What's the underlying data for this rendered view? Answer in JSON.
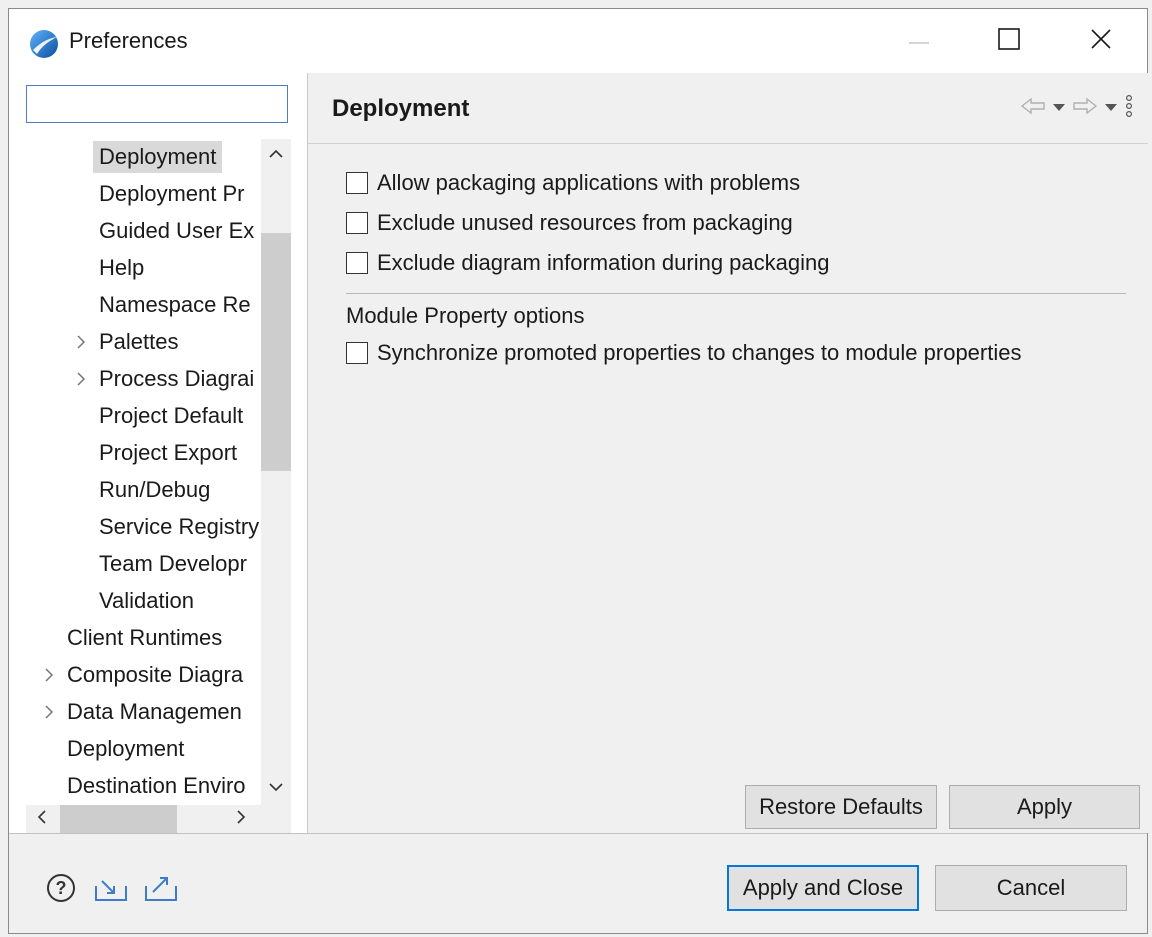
{
  "window": {
    "title": "Preferences",
    "app_icon": "eclipse-app-icon",
    "controls": [
      "minimize-icon",
      "maximize-icon",
      "close-icon"
    ]
  },
  "filter": {
    "value": "",
    "placeholder": ""
  },
  "tree": {
    "items": [
      {
        "label": "Deployment",
        "indent": 2,
        "expander": false,
        "selected": true
      },
      {
        "label": "Deployment Pr",
        "indent": 2,
        "expander": false
      },
      {
        "label": "Guided User Ex",
        "indent": 2,
        "expander": false
      },
      {
        "label": "Help",
        "indent": 2,
        "expander": false
      },
      {
        "label": "Namespace Re",
        "indent": 2,
        "expander": false
      },
      {
        "label": "Palettes",
        "indent": 2,
        "expander": true
      },
      {
        "label": "Process Diagrai",
        "indent": 2,
        "expander": true
      },
      {
        "label": "Project Default",
        "indent": 2,
        "expander": false
      },
      {
        "label": "Project Export",
        "indent": 2,
        "expander": false
      },
      {
        "label": "Run/Debug",
        "indent": 2,
        "expander": false
      },
      {
        "label": "Service Registry",
        "indent": 2,
        "expander": false
      },
      {
        "label": "Team Developr",
        "indent": 2,
        "expander": false
      },
      {
        "label": "Validation",
        "indent": 2,
        "expander": false
      },
      {
        "label": "Client Runtimes",
        "indent": 1,
        "expander": false
      },
      {
        "label": "Composite Diagra",
        "indent": 1,
        "expander": true
      },
      {
        "label": "Data Managemen",
        "indent": 1,
        "expander": true
      },
      {
        "label": "Deployment",
        "indent": 1,
        "expander": false
      },
      {
        "label": "Destination Enviro",
        "indent": 1,
        "expander": false
      }
    ]
  },
  "page": {
    "title": "Deployment",
    "options": [
      {
        "label": "Allow packaging applications with problems",
        "checked": false
      },
      {
        "label": "Exclude unused resources from packaging",
        "checked": false
      },
      {
        "label": "Exclude diagram information during packaging",
        "checked": false
      }
    ],
    "group_label": "Module Property options",
    "group_options": [
      {
        "label": "Synchronize promoted properties to changes to module properties",
        "checked": false
      }
    ],
    "restore_defaults_label": "Restore Defaults",
    "apply_label": "Apply"
  },
  "footer": {
    "apply_close_label": "Apply and Close",
    "cancel_label": "Cancel",
    "icons": [
      "help-icon",
      "import-icon",
      "export-icon"
    ]
  },
  "colors": {
    "accent": "#0078d7",
    "selection": "#d9d9d9",
    "window_bg": "#f0f0f0"
  }
}
